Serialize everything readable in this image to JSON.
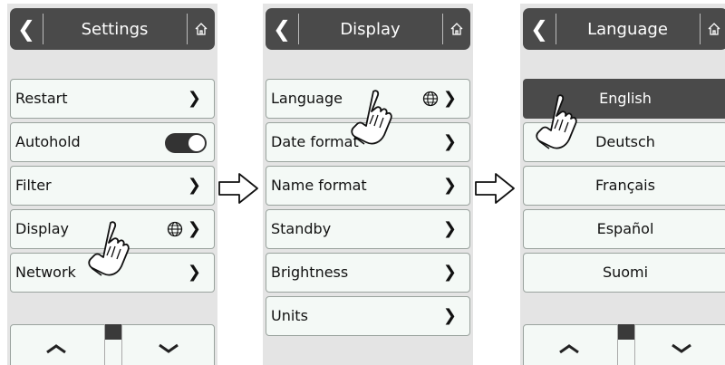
{
  "panels": [
    {
      "title": "Settings",
      "items": [
        {
          "label": "Restart"
        },
        {
          "label": "Autohold"
        },
        {
          "label": "Filter"
        },
        {
          "label": "Display"
        },
        {
          "label": "Network"
        }
      ],
      "autohold_toggle_on": true
    },
    {
      "title": "Display",
      "items": [
        {
          "label": "Language"
        },
        {
          "label": "Date format"
        },
        {
          "label": "Name format"
        },
        {
          "label": "Standby"
        },
        {
          "label": "Brightness"
        },
        {
          "label": "Units"
        }
      ]
    },
    {
      "title": "Language",
      "items": [
        {
          "label": "English",
          "selected": true
        },
        {
          "label": "Deutsch"
        },
        {
          "label": "Français"
        },
        {
          "label": "Español"
        },
        {
          "label": "Suomi"
        }
      ]
    }
  ],
  "glyphs": {
    "back": "❮",
    "chevron": "❯"
  },
  "colors": {
    "titlebar": "#4a4a4a",
    "panel_bg": "#e4e4e4",
    "item_bg": "#f4f9f6",
    "selected": "#4a4a4a"
  }
}
